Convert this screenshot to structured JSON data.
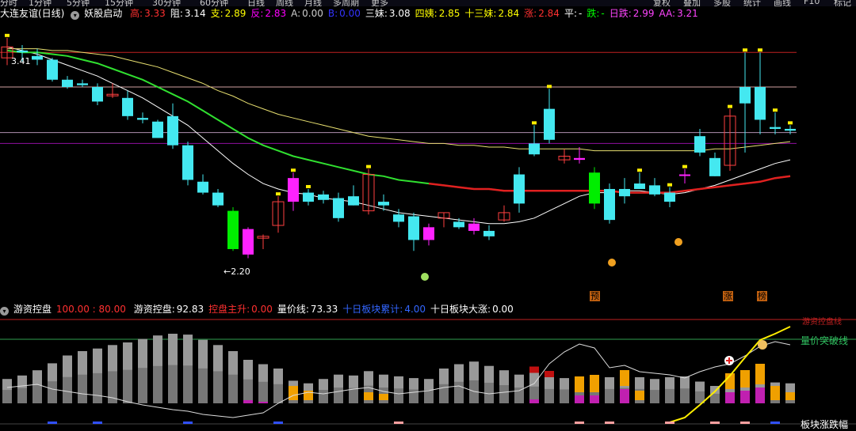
{
  "toolbar": {
    "tabs": [
      "分时",
      "1分钟",
      "5分钟",
      "15分钟",
      "30分钟",
      "60分钟",
      "日线",
      "周线",
      "月线",
      "多周期",
      "更多"
    ],
    "buttons": [
      "复权",
      "叠加",
      "多股",
      "统计",
      "画线",
      "F10",
      "标记"
    ]
  },
  "header_main": {
    "title": "大连友谊(日线)",
    "indicator_name": "妖股启动",
    "items": [
      {
        "label": "高:",
        "value": "3.33",
        "color": "#ff3030"
      },
      {
        "label": "阻:",
        "value": "3.14",
        "color": "#ffffff"
      },
      {
        "label": "支:",
        "value": "2.89",
        "color": "#ffff00"
      },
      {
        "label": "反:",
        "value": "2.83",
        "color": "#ff00ff"
      },
      {
        "label": "A:",
        "value": "0.00",
        "color": "#cccccc"
      },
      {
        "label": "B:",
        "value": "0.00",
        "color": "#3333ff"
      },
      {
        "label": "三妹:",
        "value": "3.08",
        "color": "#ffffff"
      },
      {
        "label": "四姨:",
        "value": "2.85",
        "color": "#ffff00"
      },
      {
        "label": "十三妹:",
        "value": "2.84",
        "color": "#ffff00"
      },
      {
        "label": "涨:",
        "value": "2.84",
        "color": "#ff3030"
      },
      {
        "label": "平:",
        "value": "-",
        "color": "#ffffff"
      },
      {
        "label": "跌:",
        "value": "-",
        "color": "#00ff00"
      },
      {
        "label": "日跌:",
        "value": "2.99",
        "color": "#ff44ff"
      },
      {
        "label": "AA:",
        "value": "3.21",
        "color": "#ff44ff"
      }
    ]
  },
  "header_sub": {
    "indicator_name": "游资控盘",
    "params": "100.00 : 80.00",
    "items": [
      {
        "label": "游资控盘:",
        "value": "92.83",
        "color": "#ffffff"
      },
      {
        "label": "控盘主升:",
        "value": "0.00",
        "color": "#ff3030"
      },
      {
        "label": "量价线:",
        "value": "73.33",
        "color": "#ffffff"
      },
      {
        "label": "十日板块累计:",
        "value": "4.00",
        "color": "#3366ff"
      },
      {
        "label": "十日板块大涨:",
        "value": "0.00",
        "color": "#ffffff"
      }
    ]
  },
  "annotations": {
    "high_price": "3.41",
    "low_price": "2.20",
    "low_arrow": "←",
    "yu": "预",
    "zhang": "涨",
    "bang": "榜",
    "youzi_label": "游资控盘线",
    "liangjia_label": "量价突破线",
    "bankuai_label": "板块涨跌幅"
  },
  "chart_data": {
    "type": "candlestick",
    "ohlc": [
      [
        3.3,
        3.41,
        3.26,
        3.36
      ],
      [
        3.34,
        3.37,
        3.28,
        3.33
      ],
      [
        3.31,
        3.35,
        3.26,
        3.29
      ],
      [
        3.29,
        3.3,
        3.17,
        3.18
      ],
      [
        3.18,
        3.2,
        3.13,
        3.14
      ],
      [
        3.16,
        3.18,
        3.14,
        3.15
      ],
      [
        3.14,
        3.16,
        3.04,
        3.06
      ],
      [
        3.1,
        3.16,
        3.08,
        3.1
      ],
      [
        3.08,
        3.12,
        2.96,
        2.98
      ],
      [
        2.97,
        3.0,
        2.94,
        2.96
      ],
      [
        2.95,
        2.96,
        2.86,
        2.86
      ],
      [
        2.98,
        3.05,
        2.8,
        2.82
      ],
      [
        2.82,
        2.84,
        2.6,
        2.63
      ],
      [
        2.62,
        2.66,
        2.55,
        2.56
      ],
      [
        2.56,
        2.58,
        2.48,
        2.49
      ],
      [
        2.46,
        2.48,
        2.24,
        2.25
      ],
      [
        2.22,
        2.37,
        2.2,
        2.36
      ],
      [
        2.31,
        2.33,
        2.25,
        2.32
      ],
      [
        2.38,
        2.54,
        2.34,
        2.51
      ],
      [
        2.51,
        2.67,
        2.46,
        2.64
      ],
      [
        2.56,
        2.58,
        2.49,
        2.51
      ],
      [
        2.55,
        2.57,
        2.5,
        2.52
      ],
      [
        2.53,
        2.56,
        2.4,
        2.42
      ],
      [
        2.54,
        2.6,
        2.49,
        2.49
      ],
      [
        2.46,
        2.69,
        2.44,
        2.66
      ],
      [
        2.51,
        2.55,
        2.46,
        2.49
      ],
      [
        2.44,
        2.47,
        2.37,
        2.4
      ],
      [
        2.43,
        2.45,
        2.24,
        2.3
      ],
      [
        2.37,
        2.39,
        2.27,
        2.3
      ],
      [
        2.42,
        2.45,
        2.37,
        2.45
      ],
      [
        2.4,
        2.42,
        2.36,
        2.37
      ],
      [
        2.39,
        2.42,
        2.33,
        2.35
      ],
      [
        2.35,
        2.38,
        2.3,
        2.32
      ],
      [
        2.41,
        2.49,
        2.4,
        2.45
      ],
      [
        2.66,
        2.7,
        2.45,
        2.5
      ],
      [
        2.83,
        2.93,
        2.76,
        2.77
      ],
      [
        3.02,
        3.13,
        2.83,
        2.85
      ],
      [
        2.74,
        2.8,
        2.72,
        2.76
      ],
      [
        2.75,
        2.81,
        2.72,
        2.74
      ],
      [
        2.67,
        2.7,
        2.47,
        2.5
      ],
      [
        2.58,
        2.61,
        2.39,
        2.41
      ],
      [
        2.58,
        2.64,
        2.5,
        2.54
      ],
      [
        2.61,
        2.67,
        2.58,
        2.58
      ],
      [
        2.6,
        2.64,
        2.54,
        2.55
      ],
      [
        2.56,
        2.59,
        2.48,
        2.51
      ],
      [
        2.66,
        2.69,
        2.61,
        2.66
      ],
      [
        2.87,
        2.91,
        2.76,
        2.78
      ],
      [
        2.75,
        2.78,
        2.65,
        2.65
      ],
      [
        2.71,
        3.02,
        2.68,
        2.98
      ],
      [
        3.14,
        3.33,
        2.78,
        3.05
      ],
      [
        3.14,
        3.33,
        2.88,
        2.96
      ],
      [
        2.92,
        3.0,
        2.88,
        2.91
      ],
      [
        2.91,
        2.93,
        2.88,
        2.9
      ]
    ],
    "series": [
      {
        "name": "三妹",
        "values": [
          3.36,
          3.34,
          3.32,
          3.29,
          3.26,
          3.23,
          3.2,
          3.16,
          3.12,
          3.08,
          3.03,
          2.98,
          2.93,
          2.86,
          2.79,
          2.72,
          2.66,
          2.61,
          2.58,
          2.56,
          2.55,
          2.53,
          2.52,
          2.51,
          2.49,
          2.47,
          2.45,
          2.44,
          2.43,
          2.42,
          2.41,
          2.4,
          2.39,
          2.39,
          2.4,
          2.42,
          2.46,
          2.5,
          2.54,
          2.56,
          2.56,
          2.57,
          2.57,
          2.56,
          2.55,
          2.56,
          2.58,
          2.6,
          2.63,
          2.66,
          2.69,
          2.72,
          2.74
        ]
      },
      {
        "name": "四姨",
        "values": [
          3.34,
          3.33,
          3.33,
          3.32,
          3.31,
          3.29,
          3.27,
          3.24,
          3.21,
          3.18,
          3.14,
          3.1,
          3.06,
          3.01,
          2.96,
          2.91,
          2.86,
          2.82,
          2.79,
          2.76,
          2.74,
          2.72,
          2.7,
          2.68,
          2.66,
          2.65,
          2.63,
          2.62,
          2.61,
          2.6,
          2.59,
          2.58,
          2.58,
          2.57,
          2.57,
          2.57,
          2.57,
          2.57,
          2.57,
          2.57,
          2.57,
          2.56,
          2.56,
          2.56,
          2.56,
          2.57,
          2.58,
          2.59,
          2.6,
          2.61,
          2.62,
          2.64,
          2.65
        ]
      },
      {
        "name": "十三妹",
        "values": [
          3.35,
          3.35,
          3.35,
          3.34,
          3.34,
          3.33,
          3.32,
          3.31,
          3.29,
          3.27,
          3.25,
          3.22,
          3.19,
          3.16,
          3.12,
          3.09,
          3.05,
          3.02,
          2.99,
          2.97,
          2.95,
          2.93,
          2.91,
          2.89,
          2.87,
          2.86,
          2.85,
          2.84,
          2.83,
          2.83,
          2.82,
          2.82,
          2.81,
          2.81,
          2.8,
          2.8,
          2.8,
          2.8,
          2.8,
          2.79,
          2.79,
          2.79,
          2.79,
          2.79,
          2.79,
          2.79,
          2.79,
          2.8,
          2.8,
          2.81,
          2.82,
          2.83,
          2.84
        ]
      }
    ],
    "levels": [
      {
        "name": "高",
        "value": 3.33,
        "color": "#c02020"
      },
      {
        "name": "阻",
        "value": 3.14,
        "color": "#d0a0a0"
      },
      {
        "name": "支",
        "value": 2.89,
        "color": "#b090b0"
      },
      {
        "name": "反",
        "value": 2.83,
        "color": "#9010a0"
      }
    ],
    "ylim": [
      2.15,
      3.47
    ],
    "volume_gray": [
      28,
      32,
      38,
      46,
      55,
      60,
      63,
      67,
      70,
      74,
      78,
      80,
      79,
      73,
      67,
      60,
      50,
      45,
      40,
      26,
      23,
      28,
      33,
      32,
      37,
      33,
      31,
      29,
      28,
      40,
      45,
      48,
      43,
      38,
      33,
      35,
      30,
      29,
      27,
      27,
      30,
      32,
      30,
      28,
      30,
      31,
      25,
      20,
      22,
      25,
      27,
      24,
      23
    ],
    "volume_orange": [
      0,
      0,
      0,
      0,
      0,
      0,
      0,
      0,
      0,
      0,
      0,
      0,
      0,
      0,
      0,
      0,
      0,
      0,
      0,
      18,
      12,
      0,
      0,
      0,
      10,
      8,
      0,
      0,
      0,
      0,
      0,
      0,
      0,
      0,
      0,
      0,
      0,
      0,
      20,
      22,
      0,
      20,
      12,
      0,
      0,
      0,
      0,
      0,
      20,
      22,
      26,
      18,
      10
    ],
    "volume_magenta": [
      0,
      0,
      0,
      0,
      0,
      0,
      0,
      0,
      0,
      0,
      0,
      0,
      0,
      0,
      0,
      0,
      4,
      2,
      0,
      0,
      0,
      0,
      0,
      0,
      0,
      0,
      0,
      0,
      0,
      0,
      0,
      0,
      0,
      0,
      0,
      5,
      0,
      0,
      10,
      10,
      0,
      18,
      0,
      0,
      0,
      0,
      0,
      0,
      14,
      16,
      20,
      0,
      0
    ],
    "volume_red": [
      0,
      0,
      0,
      0,
      0,
      0,
      0,
      0,
      0,
      0,
      0,
      0,
      0,
      0,
      0,
      0,
      0,
      0,
      0,
      0,
      0,
      0,
      0,
      0,
      0,
      0,
      0,
      0,
      0,
      0,
      0,
      0,
      0,
      0,
      0,
      8,
      8,
      0,
      0,
      0,
      0,
      0,
      0,
      0,
      0,
      0,
      0,
      0,
      8,
      10,
      12,
      0,
      0
    ]
  }
}
